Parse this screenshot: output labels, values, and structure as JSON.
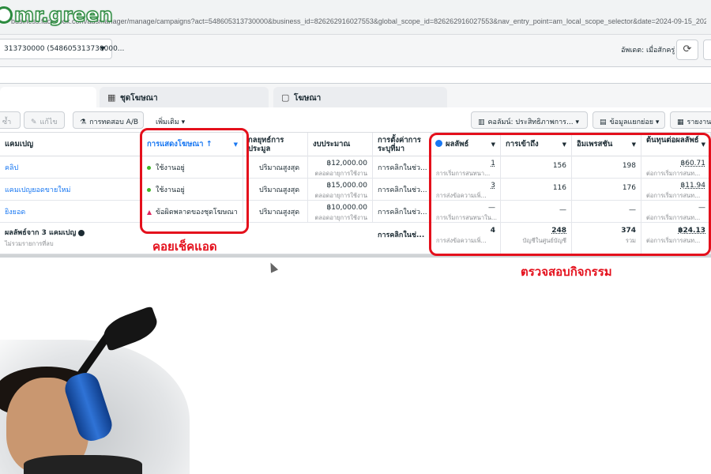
{
  "browser": {
    "url": "business.facebook.com/adsmanager/manage/campaigns?act=548605313730000&business_id=826262916027553&global_scope_id=826262916027553&nav_entry_point=am_local_scope_selector&date=2024-09-15_2024-09-16%2Ctoday&bre..."
  },
  "logo": {
    "text": "mr.green"
  },
  "account": {
    "selector": "313730000 (548605313730000...",
    "updated_label": "อัพเดต: เมื่อสักครู่"
  },
  "tabs": [
    {
      "label": "",
      "icon": "folder-icon"
    },
    {
      "label": "ชุดโฆษณา",
      "icon": "grid-icon"
    },
    {
      "label": "โฆษณา",
      "icon": "ad-icon"
    }
  ],
  "toolbar": {
    "duplicate": "ซ้ำ",
    "edit": "แก้ไข",
    "ab_test": "การทดสอบ A/B",
    "more": "เพิ่มเติม",
    "columns": "คอลัมน์: ประสิทธิภาพการ...",
    "breakdown": "ข้อมูลแยกย่อย",
    "reports": "รายงาน"
  },
  "table": {
    "headers": {
      "campaign": "แคมเปญ",
      "delivery": "การแสดงโฆษณา ↑",
      "bid_strategy": "กลยุทธ์การประมูล",
      "budget": "งบประมาณ",
      "attribution": "การตั้งค่าการระบุที่มา",
      "results": "ผลลัพธ์",
      "reach": "การเข้าถึง",
      "impressions": "อิมเพรสชัน",
      "cost_per_result": "ต้นทุนต่อผลลัพธ์"
    },
    "rows": [
      {
        "name": "คลิป",
        "delivery": "ใช้งานอยู่",
        "delivery_status": "active",
        "bid": "ปริมาณสูงสุด",
        "budget": "฿12,000.00",
        "budget_sub": "ตลอดอายุการใช้งาน",
        "attribution": "การคลิกในช่ว...",
        "results": "1",
        "results_sub": "การเริ่มการสนทนา...",
        "reach": "156",
        "impressions": "198",
        "cost": "฿60.71",
        "cost_sub": "ต่อการเริ่มการสนท..."
      },
      {
        "name": "แคมเปญยอดขายใหม่",
        "delivery": "ใช้งานอยู่",
        "delivery_status": "active",
        "bid": "ปริมาณสูงสุด",
        "budget": "฿15,000.00",
        "budget_sub": "ตลอดอายุการใช้งาน",
        "attribution": "การคลิกในช่ว...",
        "results": "3",
        "results_sub": "การส่งข้อความเพิ่...",
        "reach": "116",
        "impressions": "176",
        "cost": "฿11.94",
        "cost_sub": "ต่อการเริ่มการสนท..."
      },
      {
        "name": "ยิงยอด",
        "delivery": "ข้อผิดพลาดของชุดโฆษณา",
        "delivery_status": "error",
        "bid": "ปริมาณสูงสุด",
        "budget": "฿10,000.00",
        "budget_sub": "ตลอดอายุการใช้งาน",
        "attribution": "การคลิกในช่ว...",
        "results": "—",
        "results_sub": "การเริ่มการสนทนาใน...",
        "reach": "—",
        "impressions": "—",
        "cost": "—",
        "cost_sub": "ต่อการเริ่มการสนท..."
      }
    ],
    "total": {
      "label": "ผลลัพธ์จาก 3 แคมเปญ",
      "sub": "ไม่รวมรายการที่ลบ",
      "attribution": "การคลิกในช่...",
      "results": "4",
      "results_sub": "การส่งข้อความเพิ่...",
      "reach": "248",
      "reach_sub": "บัญชีในศูนย์บัญชี",
      "impressions": "374",
      "impressions_sub": "รวม",
      "cost": "฿24.13",
      "cost_sub": "ต่อการเริ่มการสนท..."
    }
  },
  "annotations": {
    "check_ads": "คอยเช็คแอด",
    "check_activity": "ตรวจสอบกิจกรรม"
  },
  "colors": {
    "annotation_red": "#e4101c",
    "link_blue": "#1877f2",
    "active_green": "#42b72a",
    "error_red": "#e0245e",
    "logo_green": "#2b8a3e"
  }
}
